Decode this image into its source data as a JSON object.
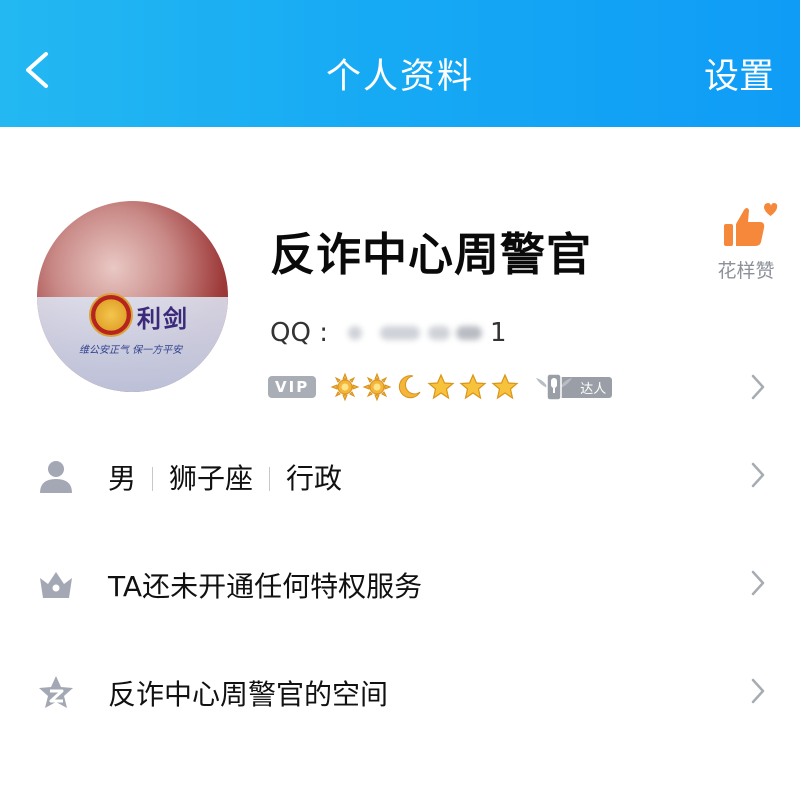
{
  "header": {
    "title": "个人资料",
    "action_label": "设置",
    "bg_color": "#16a9f4"
  },
  "profile": {
    "name": "反诈中心周警官",
    "qq_label": "QQ :",
    "qq_value_visible": "1",
    "avatar": {
      "brand_text": "利剑",
      "slogan": "维公安正气 保一方平安"
    },
    "vip_label": "VIP",
    "level_icons": [
      "sun-icon",
      "sun-icon",
      "moon-icon",
      "star-icon",
      "star-icon",
      "star-icon"
    ],
    "talent_label": "达人",
    "like": {
      "label": "花样赞",
      "icon": "thumbs-up-heart-icon",
      "color": "#f5883a"
    }
  },
  "rows": [
    {
      "icon": "person-icon",
      "parts": [
        "男",
        "狮子座",
        "行政"
      ]
    },
    {
      "icon": "crown-icon",
      "text": "TA还未开通任何特权服务"
    },
    {
      "icon": "qzone-star-icon",
      "text": "反诈中心周警官的空间"
    }
  ]
}
